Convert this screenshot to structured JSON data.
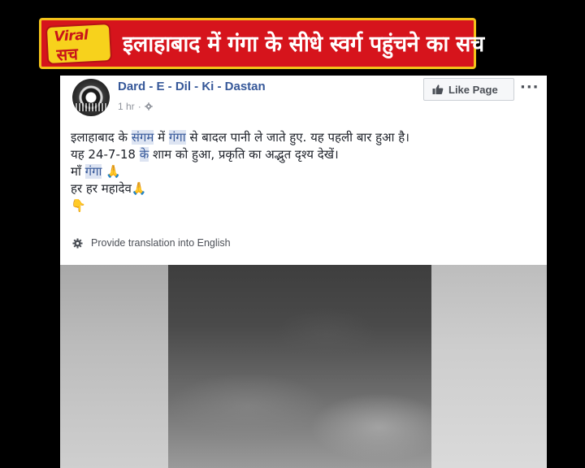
{
  "banner": {
    "logo_line1": "Viral",
    "logo_line2": "सच",
    "title": "इलाहाबाद में गंगा के सीधे स्वर्ग पहुंचने का सच"
  },
  "post": {
    "page_name": "Dard - E - Dil - Ki - Dastan",
    "time": "1 hr",
    "separator": "·",
    "like_button_label": "Like Page",
    "more_label": "···",
    "text": {
      "l1_a": "इलाहाबाद के ",
      "l1_b": "संगम",
      "l1_c": " में ",
      "l1_d": "गंगा",
      "l1_e": " से बादल पानी ले जाते हुए. यह पहली बार हुआ है।",
      "l2_a": "यह 24-7-18 ",
      "l2_b": "के",
      "l2_c": " शाम को हुआ, प्रकृति का अद्भुत दृश्य देखें।",
      "l3_a": "माँ ",
      "l3_b": "गंगा",
      "l3_emoji": " 🙏",
      "l4": "हर हर महादेव",
      "l4_emoji": "🙏",
      "l5_emoji": "👇"
    },
    "translate_label": "Provide translation into English"
  },
  "colors": {
    "banner_red": "#d6141c",
    "banner_border": "#f3c21a",
    "fb_link_blue": "#365899"
  }
}
